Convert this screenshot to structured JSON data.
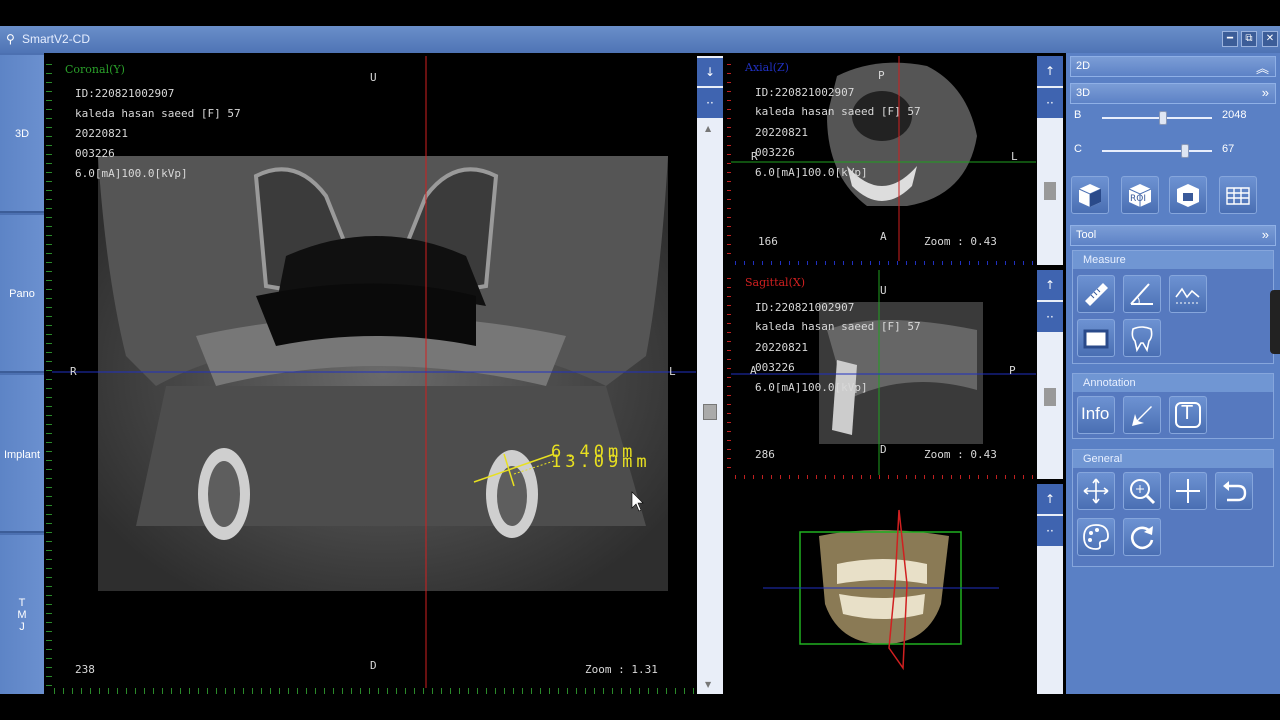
{
  "window": {
    "title": "SmartV2-CD",
    "minimize": "━",
    "restore": "⧉",
    "close": "✕"
  },
  "nav": {
    "items": [
      {
        "label": "3D"
      },
      {
        "label": "Pano"
      },
      {
        "label": "Implant"
      },
      {
        "label": "T\nM\nJ"
      }
    ]
  },
  "patient": {
    "id": "ID:220821002907",
    "name": "kaleda hasan saeed [F] 57",
    "date": "20220821",
    "number": "003226",
    "exposure": "6.0[mA]100.0[kVp]"
  },
  "coronal": {
    "title": "Coronal(Y)",
    "top": "U",
    "bottom": "D",
    "left": "R",
    "right": "L",
    "slice": "238",
    "zoom": "Zoom : 1.31",
    "measure1": "6.40mm",
    "measure2": "13.09mm"
  },
  "axial": {
    "title": "Axial(Z)",
    "top": "P",
    "bottom": "A",
    "left": "R",
    "right": "L",
    "slice": "166",
    "zoom": "Zoom : 0.43"
  },
  "sagittal": {
    "title": "Sagittal(X)",
    "top": "U",
    "bottom": "D",
    "left": "A",
    "right": "P",
    "slice": "286",
    "zoom": "Zoom : 0.43"
  },
  "strip": {
    "down_arrow": "↓",
    "up_arrow": "↑",
    "dots": "··",
    "scroll_up": "▲",
    "scroll_down": "▼"
  },
  "panel": {
    "section_2d": "2D",
    "section_3d": "3D",
    "brightness_label": "B",
    "brightness_value": "2048",
    "brightness_level": 0.55,
    "contrast_label": "C",
    "contrast_value": "67",
    "contrast_level": 0.75,
    "tool_section": "Tool",
    "measure_group": "Measure",
    "annotation_group": "Annotation",
    "general_group": "General",
    "roi_text": "ROI",
    "info_text": "Info",
    "text_tool": "T",
    "chevron_up": "︽",
    "chevron_right": "»"
  },
  "colors": {
    "accent": "#4f74b5",
    "crosshair_red": "#d02020",
    "crosshair_blue": "#2030c0",
    "measure_yellow": "#e8e020",
    "ruler_green": "#2a8a2a"
  },
  "icons": [
    "volume-render-icon",
    "roi-icon",
    "clip-icon",
    "grid-icon",
    "ruler-icon",
    "angle-icon",
    "profile-icon",
    "rectangle-icon",
    "tooth-icon",
    "info-icon",
    "arrow-icon",
    "text-icon",
    "pan-icon",
    "zoom-icon",
    "crosshair-icon",
    "undo-icon",
    "palette-icon",
    "rotate-icon"
  ]
}
